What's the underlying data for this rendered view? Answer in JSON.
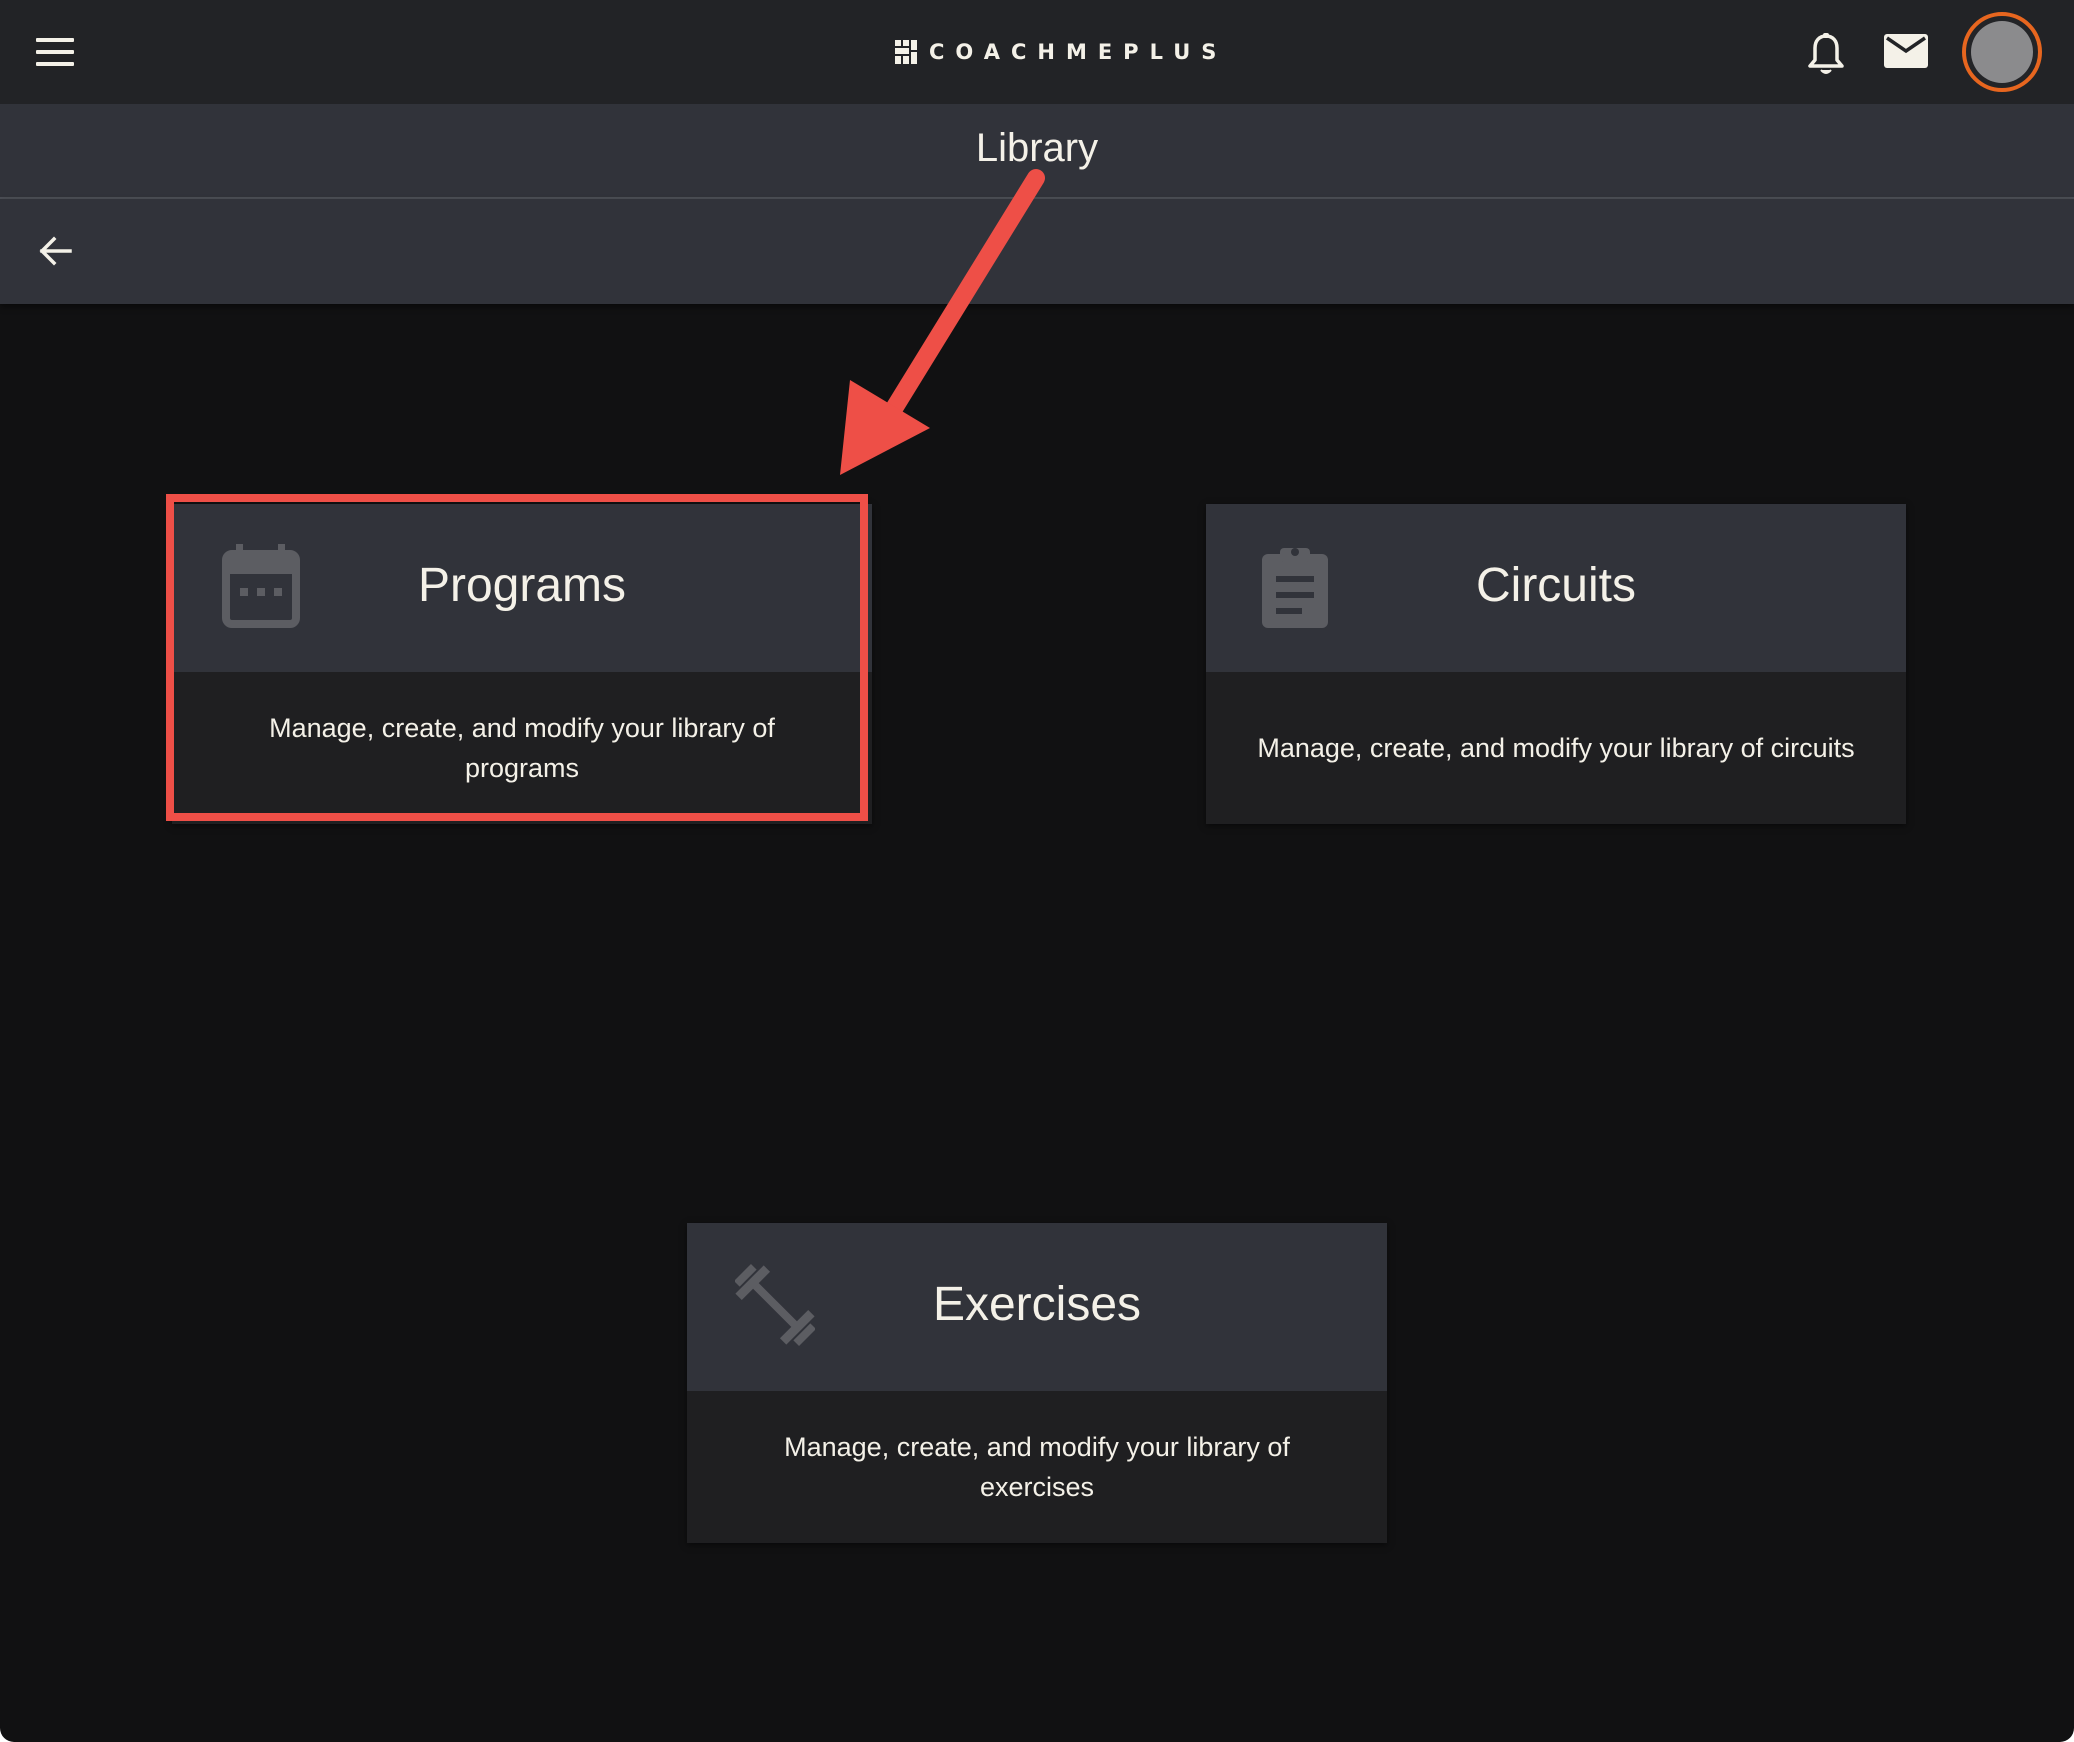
{
  "header": {
    "brand": "COACHMEPLUS",
    "menu_icon": "hamburger-menu-icon",
    "notifications_icon": "bell-icon",
    "messages_icon": "mail-icon",
    "avatar_ring_color": "#e7661f"
  },
  "page": {
    "title": "Library",
    "back_icon": "arrow-left-icon"
  },
  "cards": [
    {
      "title": "Programs",
      "icon": "calendar-icon",
      "description": "Manage, create, and modify your library of programs",
      "highlighted": true
    },
    {
      "title": "Circuits",
      "icon": "clipboard-icon",
      "description": "Manage, create, and modify your library of circuits",
      "highlighted": false
    },
    {
      "title": "Exercises",
      "icon": "dumbbell-icon",
      "description": "Manage, create, and modify your library of exercises",
      "highlighted": false
    }
  ],
  "annotation": {
    "color": "#ee4f47",
    "type": "arrow-and-box"
  },
  "colors": {
    "background": "#111112",
    "header": "#222326",
    "card_head": "#31333a",
    "card_body": "#1f1f21",
    "text": "#f4f1e8"
  }
}
